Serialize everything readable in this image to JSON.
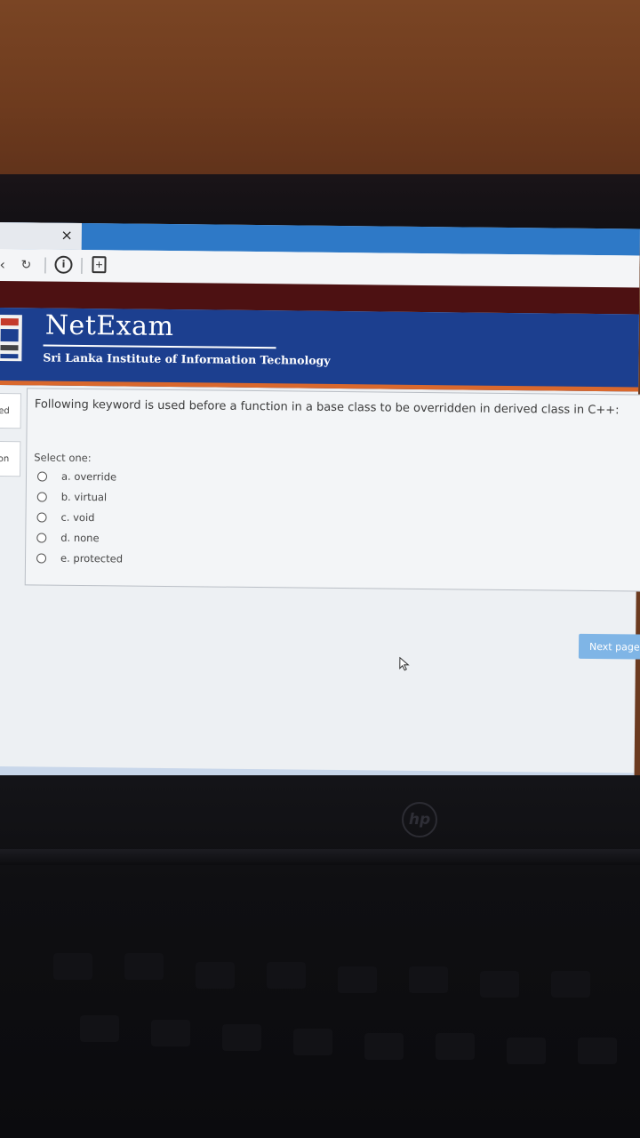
{
  "browser": {
    "tab_close_glyph": "×",
    "nav_icons": [
      "back-icon",
      "reload-icon",
      "info-icon",
      "page-icon"
    ]
  },
  "header": {
    "brand": "NetExam",
    "institute": "Sri Lanka Institute of Information Technology"
  },
  "sidebar": {
    "items": [
      {
        "label": "ed"
      },
      {
        "label": "on"
      }
    ]
  },
  "question": {
    "text": "Following keyword is used before a function in a base class to be overridden in derived class in C++:",
    "prompt": "Select one:",
    "options": [
      {
        "label": "a. override"
      },
      {
        "label": "b. virtual"
      },
      {
        "label": "c. void"
      },
      {
        "label": "d. none"
      },
      {
        "label": "e. protected"
      }
    ]
  },
  "navigation": {
    "next_label": "Next page"
  },
  "colors": {
    "header_bg": "#1c3f8f",
    "header_accent": "#d9682d",
    "tab_strip": "#2e79c7",
    "button_bg": "#7fb5e6"
  }
}
